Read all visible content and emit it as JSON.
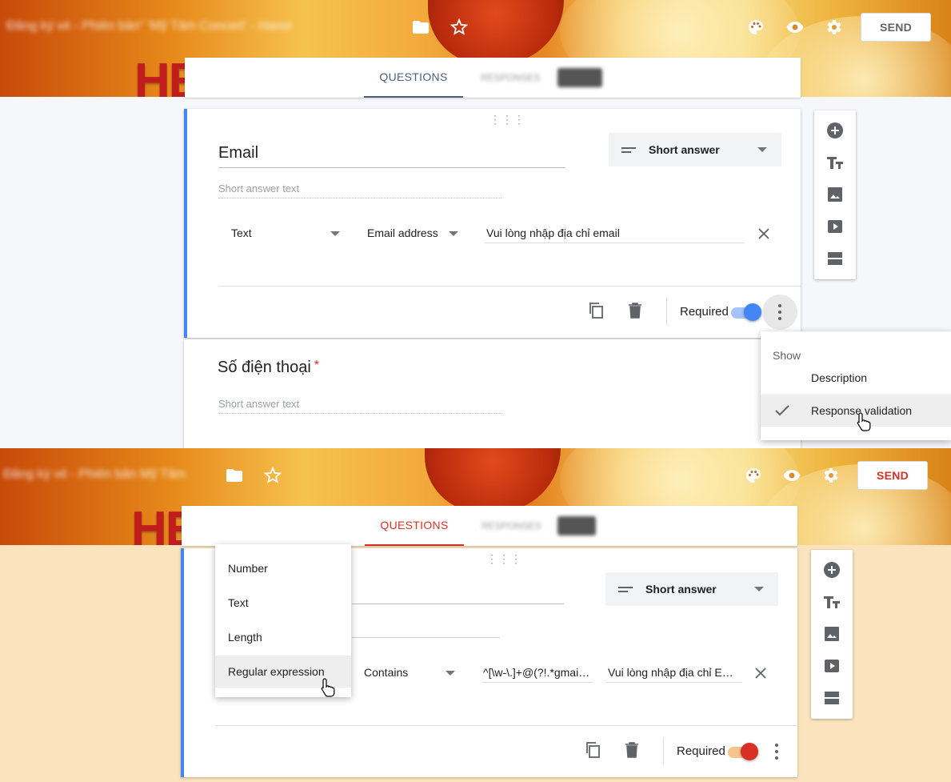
{
  "colors": {
    "blue_accent": "#4285f4",
    "red_accent": "#db3a17",
    "tab_blue": "#4f5f7a",
    "tab_red": "#d93025"
  },
  "panel1": {
    "form_title": "Đăng ký vé - Phiên bản\" 'Mỹ Tâm Concert' - Hanoi",
    "icons": [
      "folder-icon",
      "star-icon",
      "palette-icon",
      "eye-icon",
      "gear-icon"
    ],
    "send_label": "SEND",
    "tabs": {
      "questions": "QUESTIONS",
      "responses": "RESPONSES",
      "responses_count": "1234"
    },
    "question1": {
      "title": "Email",
      "answer_placeholder": "Short answer text",
      "type_label": "Short answer",
      "validation_type": "Text",
      "validation_condition": "Email address",
      "error_text": "Vui lòng nhập địa chỉ email",
      "required_label": "Required",
      "required_on": true
    },
    "question2": {
      "title": "Số điện thoại",
      "required_star": "*",
      "answer_placeholder": "Short answer text"
    },
    "menu": {
      "header": "Show",
      "items": [
        "Description",
        "Response validation"
      ],
      "checked_item": "Response validation"
    }
  },
  "panel2": {
    "form_title": "Đăng ký vé - Phiên bản Mỹ Tâm",
    "send_label": "SEND",
    "tabs": {
      "questions": "QUESTIONS",
      "responses": "RESPONSES",
      "responses_count": "123"
    },
    "question": {
      "type_label": "Short answer",
      "validation_condition": "Contains",
      "pattern": "^[\\w-\\.]+@(?!.*gmai\\.c...",
      "error_text": "Vui lòng nhập địa chỉ Email...",
      "required_label": "Required",
      "required_on": true
    },
    "dropdown": {
      "items": [
        "Number",
        "Text",
        "Length",
        "Regular expression"
      ],
      "highlighted": "Regular expression"
    }
  },
  "side_tools": [
    "add-question-icon",
    "add-title-icon",
    "add-image-icon",
    "add-video-icon",
    "add-section-icon"
  ]
}
